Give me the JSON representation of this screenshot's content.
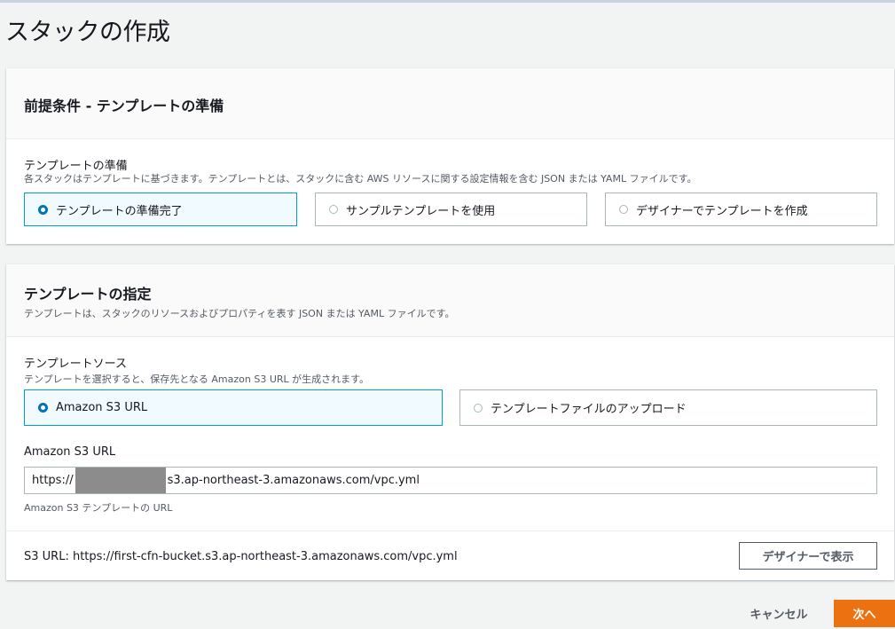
{
  "page": {
    "title": "スタックの作成"
  },
  "prereq": {
    "title": "前提条件 - テンプレートの準備",
    "field_label": "テンプレートの準備",
    "field_desc": "各スタックはテンプレートに基づきます。テンプレートとは、スタックに含む AWS リソースに関する設定情報を含む JSON または YAML ファイルです。",
    "options": [
      {
        "label": "テンプレートの準備完了",
        "selected": true
      },
      {
        "label": "サンプルテンプレートを使用",
        "selected": false
      },
      {
        "label": "デザイナーでテンプレートを作成",
        "selected": false
      }
    ]
  },
  "spec": {
    "title": "テンプレートの指定",
    "desc": "テンプレートは、スタックのリソースおよびプロパティを表す JSON または YAML ファイルです。",
    "source_label": "テンプレートソース",
    "source_desc": "テンプレートを選択すると、保存先となる Amazon S3 URL が生成されます。",
    "options": [
      {
        "label": "Amazon S3 URL",
        "selected": true
      },
      {
        "label": "テンプレートファイルのアップロード",
        "selected": false
      }
    ],
    "url_label": "Amazon S3 URL",
    "url_value_prefix": "https://",
    "url_value_suffix": "s3.ap-northeast-3.amazonaws.com/vpc.yml",
    "url_hint": "Amazon S3 テンプレートの URL",
    "s3_url_text": "S3 URL:  https://first-cfn-bucket.s3.ap-northeast-3.amazonaws.com/vpc.yml",
    "designer_button": "デザイナーで表示"
  },
  "footer": {
    "cancel": "キャンセル",
    "next": "次へ"
  },
  "colors": {
    "accent": "#0073bb",
    "primary_button": "#ec7211",
    "selected_tile_bg": "#f1faff"
  }
}
